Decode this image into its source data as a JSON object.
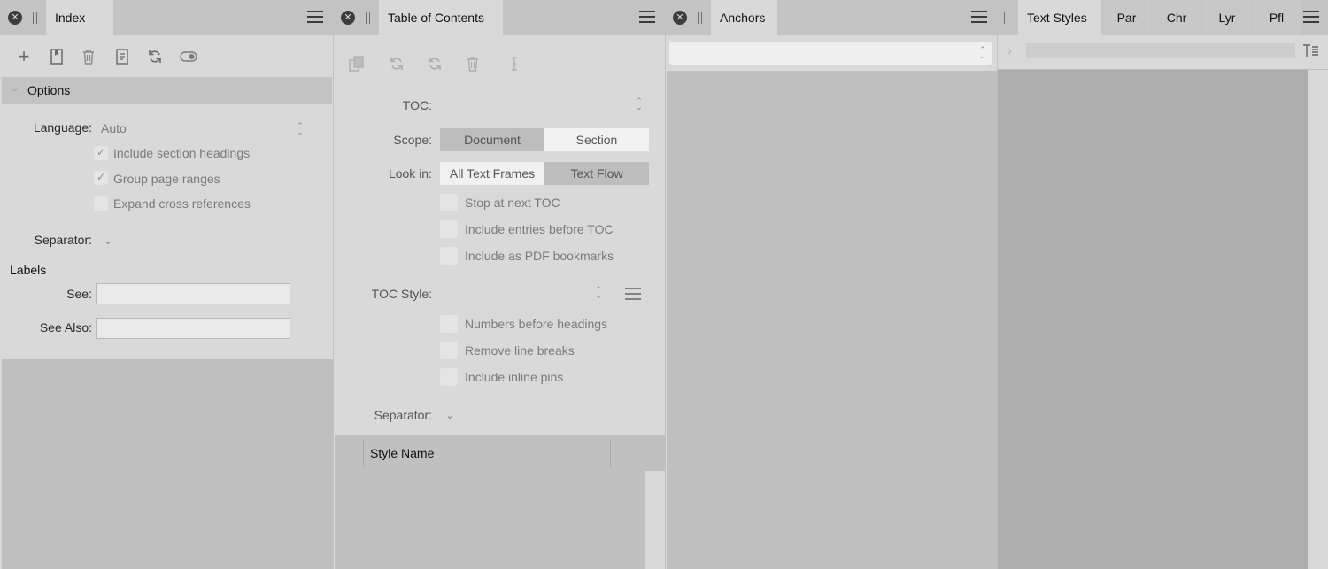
{
  "index": {
    "title": "Index",
    "options_header": "Options",
    "language_label": "Language:",
    "language_value": "Auto",
    "checks": [
      {
        "label": "Include section headings",
        "checked": true
      },
      {
        "label": "Group page ranges",
        "checked": true
      },
      {
        "label": "Expand cross references",
        "checked": false
      }
    ],
    "separator_label": "Separator:",
    "labels_header": "Labels",
    "see_label": "See:",
    "see_value": "",
    "see_also_label": "See Also:",
    "see_also_value": "",
    "toolbar": [
      "add-icon",
      "bookmark-icon",
      "trash-icon",
      "document-icon",
      "refresh-icon",
      "toggle-icon"
    ]
  },
  "toc": {
    "title": "Table of Contents",
    "toc_label": "TOC:",
    "scope_label": "Scope:",
    "scope_options": [
      "Document",
      "Section"
    ],
    "scope_selected": "Document",
    "lookin_label": "Look in:",
    "lookin_options": [
      "All Text Frames",
      "Text Flow"
    ],
    "lookin_selected": "Text Flow",
    "checks_a": [
      {
        "label": "Stop at next TOC",
        "checked": false
      },
      {
        "label": "Include entries before TOC",
        "checked": false
      },
      {
        "label": "Include as PDF bookmarks",
        "checked": false
      }
    ],
    "style_label": "TOC Style:",
    "checks_b": [
      {
        "label": "Numbers before headings",
        "checked": false
      },
      {
        "label": "Remove line breaks",
        "checked": false
      },
      {
        "label": "Include inline pins",
        "checked": false
      }
    ],
    "separator_label": "Separator:",
    "table_header": "Style Name",
    "toolbar": [
      "copy-icon",
      "refresh-icon",
      "sync-icon",
      "trash-icon",
      "text-cursor-icon"
    ]
  },
  "anchors": {
    "title": "Anchors",
    "dropdown_value": ""
  },
  "styles": {
    "tabs": [
      "Text Styles",
      "Par",
      "Chr",
      "Lyr",
      "Pfl"
    ],
    "active_tab": "Text Styles"
  },
  "colors": {
    "panel_bg": "#d9d9d9",
    "chrome_bg": "#c3c3c3",
    "list_bg": "#c0c0c0"
  }
}
